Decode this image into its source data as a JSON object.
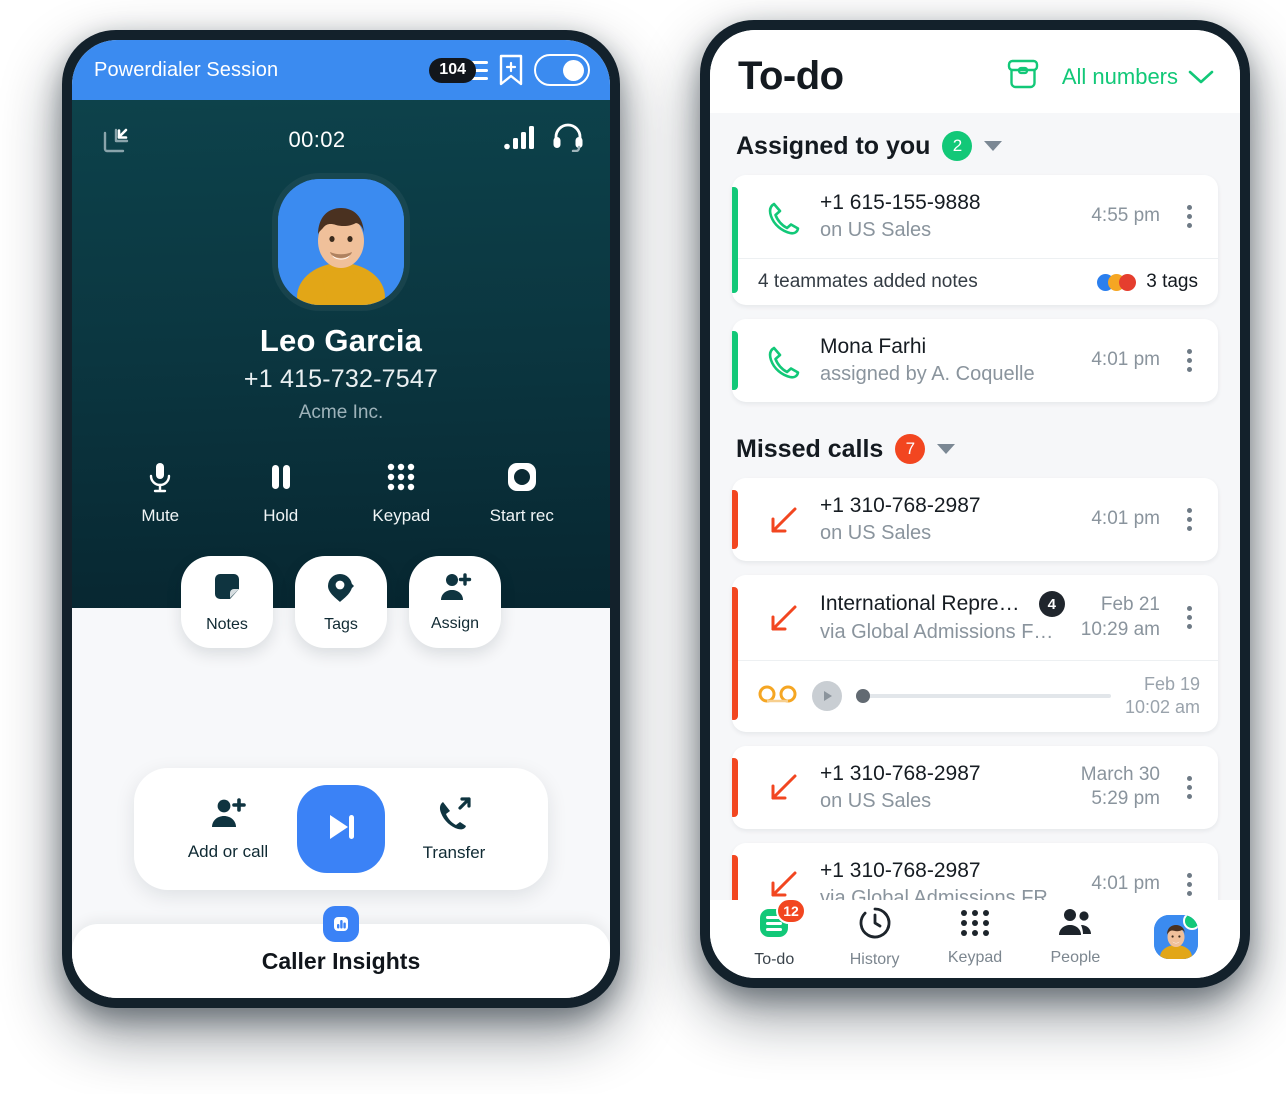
{
  "powerdialer": {
    "header": {
      "title": "Powerdialer Session",
      "queue_count": "104",
      "menu_icon": "hamburger-menu-icon",
      "bookmark_icon": "bookmark-add-icon",
      "toggle_state": "on",
      "bg_color": "#3b8bf0"
    },
    "status": {
      "minimize_icon": "minimize-icon",
      "timer": "00:02",
      "signal_icon": "signal-bars-icon",
      "headset_icon": "headset-icon"
    },
    "contact": {
      "avatar": "contact-avatar",
      "name": "Leo Garcia",
      "phone": "+1 415-732-7547",
      "company": "Acme Inc."
    },
    "call_actions": [
      {
        "icon": "microphone-icon",
        "label": "Mute"
      },
      {
        "icon": "pause-icon",
        "label": "Hold"
      },
      {
        "icon": "keypad-icon",
        "label": "Keypad"
      },
      {
        "icon": "record-icon",
        "label": "Start rec"
      }
    ],
    "quick_actions": [
      {
        "icon": "note-icon",
        "label": "Notes"
      },
      {
        "icon": "tag-icon",
        "label": "Tags"
      },
      {
        "icon": "person-add-icon",
        "label": "Assign"
      }
    ],
    "call_bar": {
      "left": {
        "icon": "person-add-icon",
        "label": "Add or call"
      },
      "center": {
        "icon": "skip-next-icon",
        "label": "Next call",
        "color": "#3b82f6"
      },
      "right": {
        "icon": "call-transfer-icon",
        "label": "Transfer"
      }
    },
    "insights": {
      "chip_icon": "bar-chart-icon",
      "label": "Caller Insights"
    }
  },
  "todo": {
    "header": {
      "title": "To-do",
      "archive_icon": "archive-icon",
      "filter_label": "All numbers",
      "filter_caret": "chevron-down-icon",
      "accent_color": "#12c878"
    },
    "sections": [
      {
        "title": "Assigned to you",
        "count": "2",
        "count_color": "#12c878",
        "caret": "caret-down-icon",
        "items": [
          {
            "accent": "green",
            "icon": "phone-outline-icon",
            "title": "+1 615-155-9888",
            "subtitle": "on US Sales",
            "time": "4:55 pm",
            "menu": "kebab-menu-icon",
            "footer": {
              "text": "4 teammates added notes",
              "tags_label": "3 tags",
              "tag_colors": [
                "#2b7fee",
                "#f5a623",
                "#e53e2e"
              ]
            }
          },
          {
            "accent": "green",
            "icon": "phone-outline-icon",
            "title": "Mona Farhi",
            "subtitle": "assigned by A. Coquelle",
            "time": "4:01 pm",
            "menu": "kebab-menu-icon"
          }
        ]
      },
      {
        "title": "Missed calls",
        "count": "7",
        "count_color": "#f24620",
        "caret": "caret-down-icon",
        "items": [
          {
            "accent": "red",
            "icon": "missed-call-icon",
            "title": "+1 310-768-2987",
            "subtitle": "on US Sales",
            "time": "4:01 pm",
            "menu": "kebab-menu-icon"
          },
          {
            "accent": "red",
            "icon": "missed-call-icon",
            "title": "International Representat...",
            "badge": "4",
            "subtitle": "via Global Admissions FR [In...",
            "time_line1": "Feb 21",
            "time_line2": "10:29 am",
            "menu": "kebab-menu-icon",
            "voicemail": {
              "icon": "voicemail-icon",
              "play_icon": "play-icon",
              "progress": 2,
              "date_line1": "Feb 19",
              "date_line2": "10:02 am"
            }
          },
          {
            "accent": "red",
            "icon": "missed-call-icon",
            "title": "+1 310-768-2987",
            "subtitle": "on US Sales",
            "time_line1": "March 30",
            "time_line2": "5:29 pm",
            "menu": "kebab-menu-icon"
          },
          {
            "accent": "red",
            "icon": "missed-call-icon",
            "title": "+1 310-768-2987",
            "subtitle": "via Global Admissions FR",
            "time": "4:01 pm",
            "menu": "kebab-menu-icon"
          }
        ]
      }
    ],
    "nav": [
      {
        "icon": "todo-list-icon",
        "label": "To-do",
        "badge": "12",
        "active": true
      },
      {
        "icon": "history-clock-icon",
        "label": "History",
        "active": false
      },
      {
        "icon": "keypad-icon",
        "label": "Keypad",
        "active": false
      },
      {
        "icon": "people-icon",
        "label": "People",
        "active": false
      },
      {
        "icon": "user-avatar",
        "label": "",
        "active": false,
        "status": "online"
      }
    ]
  }
}
